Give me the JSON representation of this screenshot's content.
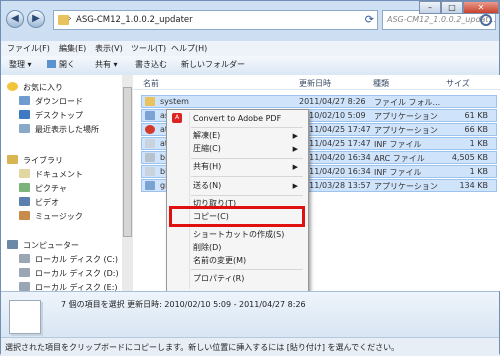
{
  "window": {
    "title": "ASG-CM12_1.0.0.2_updater",
    "address": "ASG-CM12_1.0.0.2_updater",
    "search_placeholder": "ASG-CM12_1.0.0.2_updat...",
    "back_icon": "back-arrow-icon",
    "forward_icon": "forward-arrow-icon"
  },
  "window_controls": {
    "minimize": "–",
    "maximize": "□",
    "close": "✕"
  },
  "menu": [
    "ファイル(F)",
    "編集(E)",
    "表示(V)",
    "ツール(T)",
    "ヘルプ(H)"
  ],
  "toolbar": {
    "organize": "整理 ▾",
    "open": "開く",
    "share": "共有 ▾",
    "burn": "書き込む",
    "new_folder": "新しいフォルダー"
  },
  "nav": {
    "favorites": "お気に入り",
    "fav_items": [
      "ダウンロード",
      "デスクトップ",
      "最近表示した場所"
    ],
    "libraries": "ライブラリ",
    "lib_items": [
      "ドキュメント",
      "ピクチャ",
      "ビデオ",
      "ミュージック"
    ],
    "computer": "コンピューター",
    "drives": [
      "ローカル ディスク (C:)",
      "ローカル ディスク (D:)",
      "ローカル ディスク (E:)"
    ]
  },
  "columns": {
    "name": "名前",
    "date": "更新日時",
    "type": "種類",
    "size": "サイズ"
  },
  "files": [
    {
      "name": "system",
      "date": "2011/04/27 8:26",
      "type": "ファイル フォル...",
      "size": ""
    },
    {
      "name": "asis",
      "date": "2010/02/10 5:09",
      "type": "アプリケーション",
      "size": "61 KB"
    },
    {
      "name": "atlas",
      "date": "2011/04/25 17:47",
      "type": "アプリケーション",
      "size": "66 KB"
    },
    {
      "name": "atlas",
      "date": "2011/04/25 17:47",
      "type": "INF ファイル",
      "size": "1 KB"
    },
    {
      "name": "bitrn",
      "date": "2011/04/20 16:34",
      "type": "ARC ファイル",
      "size": "4,505 KB"
    },
    {
      "name": "bitrn",
      "date": "2011/04/20 16:34",
      "type": "INF ファイル",
      "size": "1 KB"
    },
    {
      "name": "gm",
      "date": "2011/03/28 13:57",
      "type": "アプリケーション",
      "size": "134 KB"
    }
  ],
  "context_menu": {
    "convert_pdf": "Convert to Adobe PDF",
    "extract": "解凍(E)",
    "compress": "圧縮(C)",
    "share": "共有(H)",
    "send_to": "送る(N)",
    "cut": "切り取り(T)",
    "copy": "コピー(C)",
    "shortcut": "ショートカットの作成(S)",
    "delete": "削除(D)",
    "rename": "名前の変更(M)",
    "properties": "プロパティ(R)"
  },
  "details": {
    "summary": "7 個の項目を選択  更新日時: 2010/02/10 5:09 - 2011/04/27 8:26"
  },
  "status": "選択された項目をクリップボードにコピーします。新しい位置に挿入するには [貼り付け] を選んでください。",
  "colors": {
    "highlight": "#e01010",
    "selection": "#cfe3fb"
  }
}
